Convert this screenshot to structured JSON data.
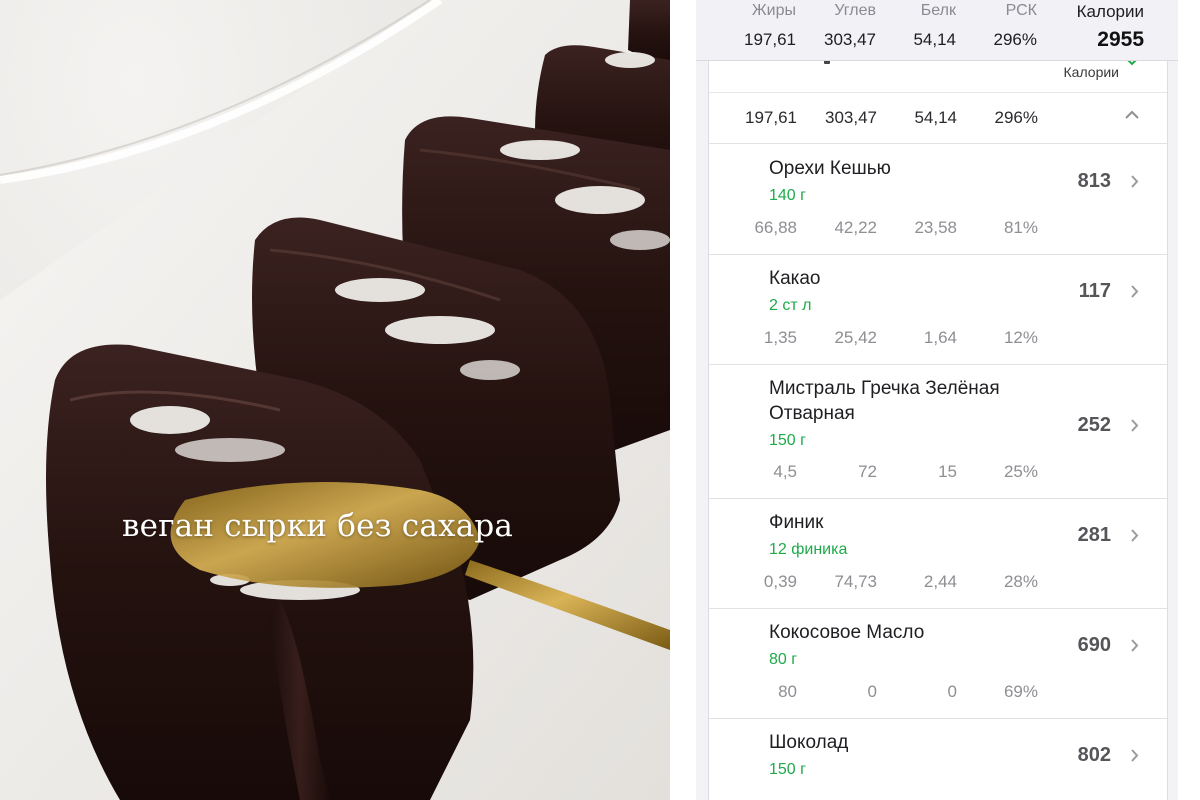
{
  "photo": {
    "caption": "веган сырки без сахара"
  },
  "summary": {
    "headers": [
      "Жиры",
      "Углев",
      "Белк",
      "РСК",
      "Калории"
    ],
    "values": [
      "197,61",
      "303,47",
      "54,14",
      "296%",
      "2955"
    ]
  },
  "section": {
    "kcal_label": "Калории",
    "totals": [
      "197,61",
      "303,47",
      "54,14",
      "296%"
    ]
  },
  "ingredients": [
    {
      "name": "Орехи Кешью",
      "qty": "140 г",
      "kcal": "813",
      "vals": [
        "66,88",
        "42,22",
        "23,58",
        "81%"
      ]
    },
    {
      "name": "Какао",
      "qty": "2 ст л",
      "kcal": "117",
      "vals": [
        "1,35",
        "25,42",
        "1,64",
        "12%"
      ]
    },
    {
      "name": "Мистраль Гречка Зелёная Отварная",
      "qty": "150 г",
      "kcal": "252",
      "vals": [
        "4,5",
        "72",
        "15",
        "25%"
      ]
    },
    {
      "name": "Финик",
      "qty": "12 финика",
      "kcal": "281",
      "vals": [
        "0,39",
        "74,73",
        "2,44",
        "28%"
      ]
    },
    {
      "name": "Кокосовое Масло",
      "qty": "80 г",
      "kcal": "690",
      "vals": [
        "80",
        "0",
        "0",
        "69%"
      ]
    },
    {
      "name": "Шоколад",
      "qty": "150 г",
      "kcal": "802",
      "vals": [
        "",
        "",
        "",
        ""
      ]
    }
  ],
  "colors": {
    "qty_green": "#1faa4a",
    "accent": "#1e1e22"
  }
}
